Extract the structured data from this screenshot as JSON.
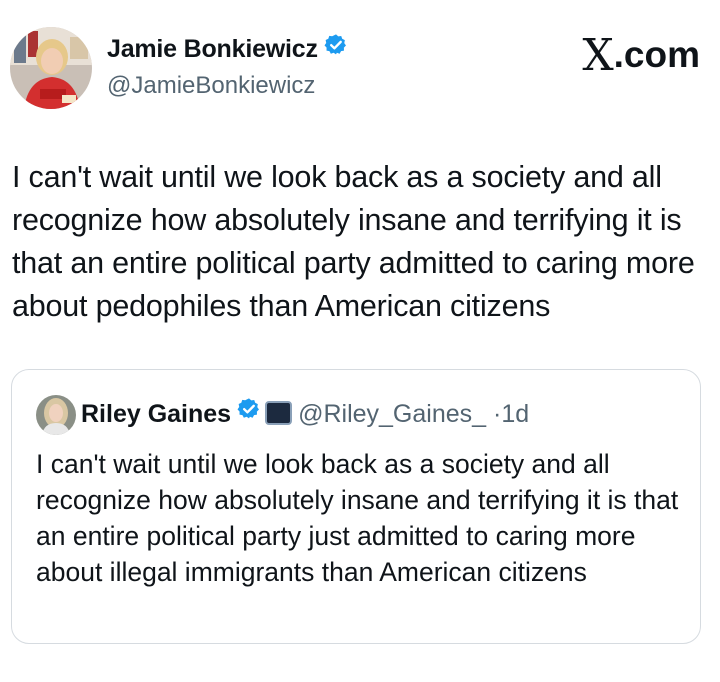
{
  "author": {
    "name": "Jamie Bonkiewicz",
    "handle": "@JamieBonkiewicz",
    "verified": true
  },
  "site": {
    "logo_letter": "X",
    "logo_suffix": ".com"
  },
  "tweet": {
    "text": "I can't wait until we look back as a society and all recognize how absolutely insane and terrifying it is that an entire political party admitted to caring more about pedophiles than American citizens"
  },
  "quoted": {
    "name": "Riley Gaines",
    "handle": "@Riley_Gaines_",
    "separator": "·",
    "time": "1d",
    "verified": true,
    "text": "I can't wait until we look back as a society and all recognize how absolutely insane and terrifying it is that an entire political party just admitted to caring more about illegal immigrants than American citizens"
  },
  "colors": {
    "verified": "#1d9bf0",
    "secondary_text": "#536471",
    "primary_text": "#0f1419",
    "card_border": "#d6dbe0"
  }
}
